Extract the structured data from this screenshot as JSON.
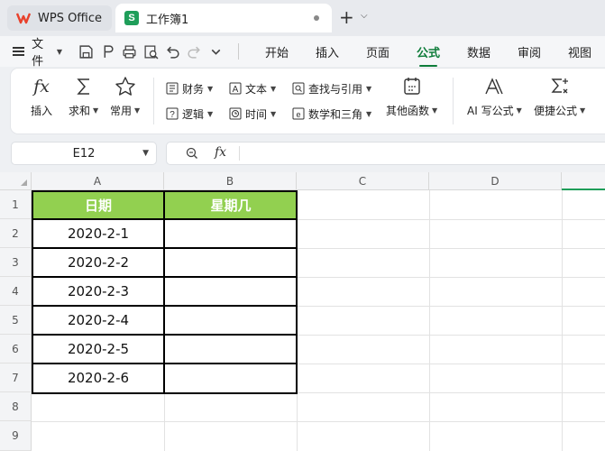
{
  "app_tab": {
    "label": "WPS Office"
  },
  "doc_tab": {
    "label": "工作簿1"
  },
  "menu": {
    "file_label": "文件",
    "tabs": [
      {
        "label": "开始"
      },
      {
        "label": "插入"
      },
      {
        "label": "页面"
      },
      {
        "label": "公式",
        "active": true
      },
      {
        "label": "数据"
      },
      {
        "label": "审阅"
      },
      {
        "label": "视图"
      }
    ]
  },
  "ribbon": {
    "insert_fn": "插入",
    "autosum": "求和",
    "common": "常用",
    "finance": "财务",
    "text": "文本",
    "lookup": "查找与引用",
    "logic": "逻辑",
    "datetime": "时间",
    "math": "数学和三角",
    "other_fn": "其他函数",
    "ai_formula": "AI 写公式",
    "quick_formula": "便捷公式"
  },
  "formula_bar": {
    "cell_ref": "E12",
    "fx_label": "fx",
    "content": ""
  },
  "sheet": {
    "columns": [
      "A",
      "B",
      "C",
      "D"
    ],
    "rows": [
      "1",
      "2",
      "3",
      "4",
      "5",
      "6",
      "7",
      "8",
      "9"
    ],
    "headers": [
      "日期",
      "星期几"
    ],
    "dates": [
      "2020-2-1",
      "2020-2-2",
      "2020-2-3",
      "2020-2-4",
      "2020-2-5",
      "2020-2-6"
    ]
  },
  "colors": {
    "header_fill": "#92d050",
    "accent": "#0e7c3a",
    "wps_red": "#e8412b"
  }
}
